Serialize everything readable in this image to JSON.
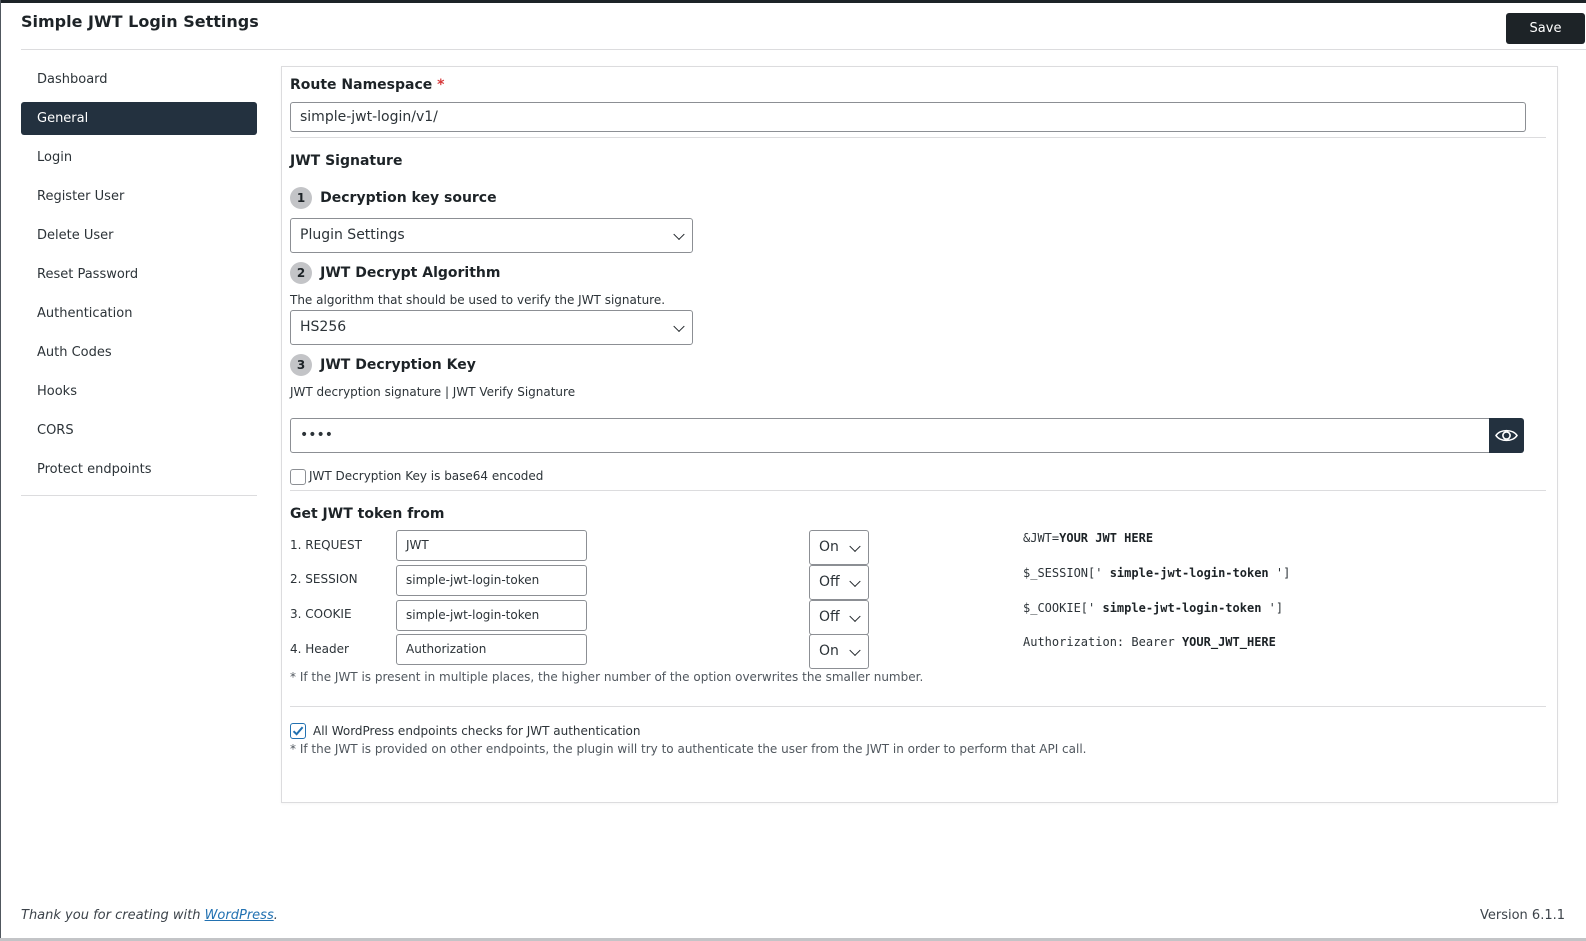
{
  "header": {
    "title": "Simple JWT Login Settings",
    "save_label": "Save"
  },
  "sidebar": {
    "items": [
      {
        "label": "Dashboard"
      },
      {
        "label": "General",
        "active": true
      },
      {
        "label": "Login"
      },
      {
        "label": "Register User"
      },
      {
        "label": "Delete User"
      },
      {
        "label": "Reset Password"
      },
      {
        "label": "Authentication"
      },
      {
        "label": "Auth Codes"
      },
      {
        "label": "Hooks"
      },
      {
        "label": "CORS"
      },
      {
        "label": "Protect endpoints"
      }
    ]
  },
  "main": {
    "route_namespace": {
      "label": "Route Namespace",
      "required_mark": "*",
      "value": "simple-jwt-login/v1/"
    },
    "jwt_signature": {
      "heading": "JWT Signature",
      "step1": {
        "number": "1",
        "title": "Decryption key source",
        "selected": "Plugin Settings"
      },
      "step2": {
        "number": "2",
        "title": "JWT Decrypt Algorithm",
        "description": "The algorithm that should be used to verify the JWT signature.",
        "selected": "HS256"
      },
      "step3": {
        "number": "3",
        "title": "JWT Decryption Key",
        "description": "JWT decryption signature | JWT Verify Signature",
        "value": "••••",
        "eye_icon": "eye-icon"
      },
      "base64_label": "JWT Decryption Key is base64 encoded",
      "base64_checked": false
    },
    "get_token": {
      "heading": "Get JWT token from",
      "rows": [
        {
          "label": "1. REQUEST",
          "value": "JWT",
          "state": "On",
          "example_prefix": "&JWT=",
          "example_bold": "YOUR JWT HERE",
          "example_suffix": ""
        },
        {
          "label": "2. SESSION",
          "value": "simple-jwt-login-token",
          "state": "Off",
          "example_prefix": "$_SESSION[' ",
          "example_bold": "simple-jwt-login-token",
          "example_suffix": " ']"
        },
        {
          "label": "3. COOKIE",
          "value": "simple-jwt-login-token",
          "state": "Off",
          "example_prefix": "$_COOKIE[' ",
          "example_bold": "simple-jwt-login-token",
          "example_suffix": " ']"
        },
        {
          "label": "4. Header",
          "value": "Authorization",
          "state": "On",
          "example_prefix": "Authorization: Bearer ",
          "example_bold": "YOUR_JWT_HERE",
          "example_suffix": ""
        }
      ],
      "note": "* If the JWT is present in multiple places, the higher number of the option overwrites the smaller number."
    },
    "all_endpoints": {
      "label": "All WordPress endpoints checks for JWT authentication",
      "checked": true,
      "note": "* If the JWT is provided on other endpoints, the plugin will try to authenticate the user from the JWT in order to perform that API call."
    }
  },
  "footer": {
    "thanks_prefix": "Thank you for creating with ",
    "thanks_link": "WordPress",
    "thanks_suffix": ".",
    "version": "Version 6.1.1"
  },
  "colors": {
    "dark": "#1d2327",
    "sidebar_active": "#23313f",
    "link": "#2271b1",
    "required": "#d63638"
  }
}
